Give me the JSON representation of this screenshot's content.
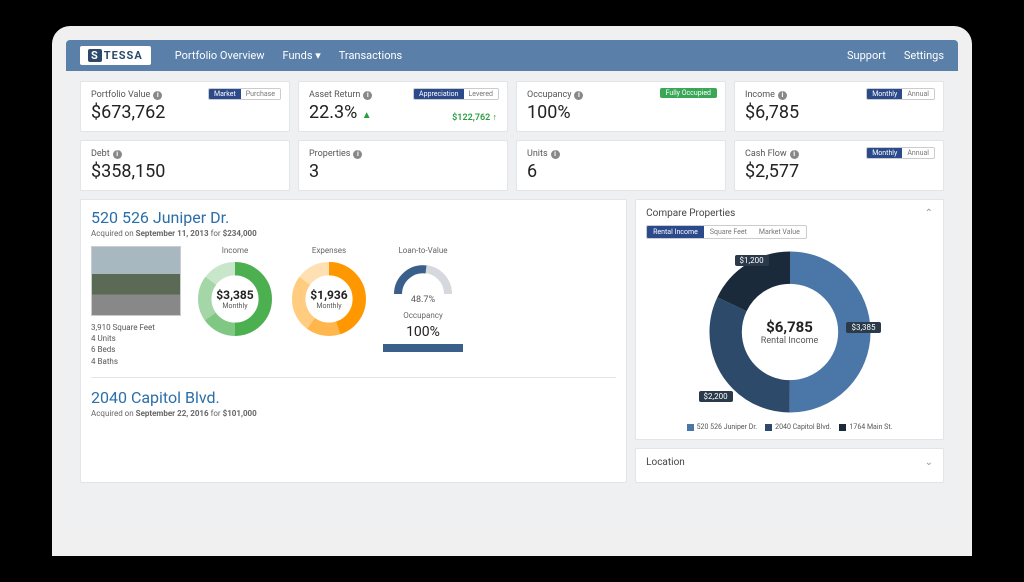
{
  "brand": {
    "prefix": "S",
    "name": "TESSA"
  },
  "nav": {
    "items": [
      "Portfolio Overview",
      "Funds",
      "Transactions"
    ],
    "right": [
      "Support",
      "Settings"
    ]
  },
  "kpi_row1": [
    {
      "label": "Portfolio Value",
      "value": "$673,762",
      "toggle": [
        "Market",
        "Purchase"
      ],
      "toggle_active": 0
    },
    {
      "label": "Asset Return",
      "value": "22.3%",
      "toggle": [
        "Appreciation",
        "Levered"
      ],
      "toggle_active": 0,
      "delta": "$122,762 ↑",
      "up": true
    },
    {
      "label": "Occupancy",
      "value": "100%",
      "badge": "Fully Occupied"
    },
    {
      "label": "Income",
      "value": "$6,785",
      "toggle": [
        "Monthly",
        "Annual"
      ],
      "toggle_active": 0
    }
  ],
  "kpi_row2": [
    {
      "label": "Debt",
      "value": "$358,150"
    },
    {
      "label": "Properties",
      "value": "3"
    },
    {
      "label": "Units",
      "value": "6"
    },
    {
      "label": "Cash Flow",
      "value": "$2,577",
      "toggle": [
        "Monthly",
        "Annual"
      ],
      "toggle_active": 0
    }
  ],
  "property1": {
    "title": "520 526 Juniper Dr.",
    "acquired_label": "Acquired on",
    "acquired_date": "September 11, 2013",
    "acquired_for": "for",
    "acquired_price": "$234,000",
    "income": {
      "label": "Income",
      "value": "$3,385",
      "period": "Monthly"
    },
    "expenses": {
      "label": "Expenses",
      "value": "$1,936",
      "period": "Monthly"
    },
    "ltv": {
      "label": "Loan-to-Value",
      "value": "48.7%"
    },
    "occupancy": {
      "label": "Occupancy",
      "value": "100%"
    },
    "stats": [
      "3,910 Square Feet",
      "4 Units",
      "6 Beds",
      "4 Baths"
    ]
  },
  "property2": {
    "title": "2040 Capitol Blvd.",
    "acquired_label": "Acquired on",
    "acquired_date": "September 22, 2016",
    "acquired_for": "for",
    "acquired_price": "$101,000"
  },
  "compare": {
    "title": "Compare Properties",
    "toggle": [
      "Rental Income",
      "Square Feet",
      "Market Value"
    ],
    "toggle_active": 0,
    "center_value": "$6,785",
    "center_label": "Rental Income",
    "slices": [
      {
        "label": "$3,385",
        "color": "#4a77a8"
      },
      {
        "label": "$2,200",
        "color": "#2d4a6b"
      },
      {
        "label": "$1,200",
        "color": "#1a2a3a"
      }
    ],
    "legend": [
      {
        "label": "520 526 Juniper Dr.",
        "color": "#4a77a8"
      },
      {
        "label": "2040 Capitol Blvd.",
        "color": "#2d4a6b"
      },
      {
        "label": "1764 Main St.",
        "color": "#1a2a3a"
      }
    ]
  },
  "location_panel": "Location",
  "chart_data": [
    {
      "type": "pie",
      "title": "Income",
      "values": [
        3385
      ],
      "segments_pct": [
        50,
        15,
        20,
        15
      ],
      "colors": [
        "#4caf50",
        "#81c784",
        "#a5d6a7",
        "#c8e6c9"
      ],
      "center": "$3,385 Monthly"
    },
    {
      "type": "pie",
      "title": "Expenses",
      "values": [
        1936
      ],
      "segments_pct": [
        45,
        15,
        25,
        15
      ],
      "colors": [
        "#ff9800",
        "#ffb74d",
        "#ffcc80",
        "#ffe0b2"
      ],
      "center": "$1,936 Monthly"
    },
    {
      "type": "gauge",
      "title": "Loan-to-Value",
      "value": 48.7,
      "max": 100
    },
    {
      "type": "pie",
      "title": "Rental Income",
      "series": [
        {
          "name": "520 526 Juniper Dr.",
          "value": 3385
        },
        {
          "name": "2040 Capitol Blvd.",
          "value": 2200
        },
        {
          "name": "1764 Main St.",
          "value": 1200
        }
      ],
      "total": 6785
    }
  ]
}
